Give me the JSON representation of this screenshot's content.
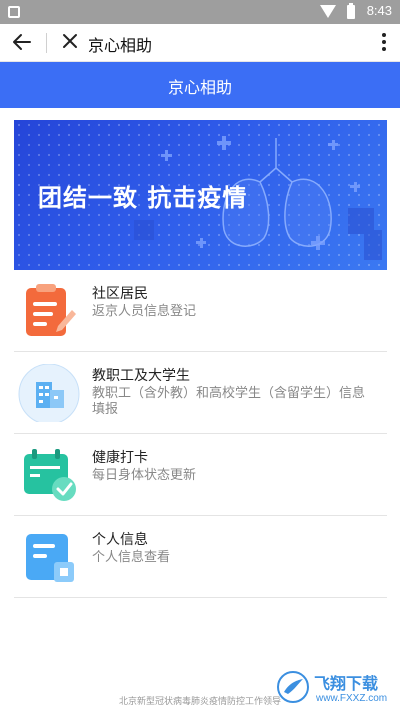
{
  "status_bar": {
    "time": "8:43"
  },
  "browser": {
    "title": "京心相助"
  },
  "header": {
    "title": "京心相助"
  },
  "banner": {
    "slogan": "团结一致 抗击疫情"
  },
  "menu": [
    {
      "title": "社区居民",
      "desc": "返京人员信息登记",
      "icon": "clipboard-pen-icon"
    },
    {
      "title": "教职工及大学生",
      "desc": "教职工（含外教）和高校学生（含留学生）信息填报",
      "icon": "building-icon"
    },
    {
      "title": "健康打卡",
      "desc": "每日身体状态更新",
      "icon": "calendar-check-icon"
    },
    {
      "title": "个人信息",
      "desc": "个人信息查看",
      "icon": "id-card-icon"
    }
  ],
  "footer": {
    "text": "北京新型冠状病毒肺炎疫情防控工作领导"
  },
  "watermark": {
    "brand": "飞翔下载",
    "site": "www.FXXZ.com"
  },
  "colors": {
    "primary": "#3b6ef5",
    "banner": "#2f5cea",
    "orange": "#f36a3c",
    "teal": "#26c2a0",
    "sky": "#4aa9f5"
  }
}
